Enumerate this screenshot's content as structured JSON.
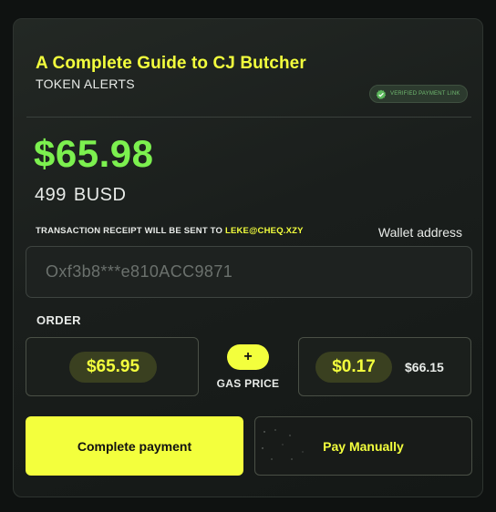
{
  "header": {
    "title": "A Complete Guide to CJ Butcher",
    "subtitle": "TOKEN ALERTS",
    "verified_badge": "VERIFIED PAYMENT LINK"
  },
  "price": {
    "amount": "$65.98",
    "token_amount": "499",
    "token_currency": "BUSD"
  },
  "receipt": {
    "prefix": "TRANSACTION RECEIPT WILL BE SENT TO",
    "email": "LEKE@CHEQ.XZY"
  },
  "wallet": {
    "label": "Wallet address",
    "placeholder": "Oxf3b8***e810ACC9871"
  },
  "order": {
    "label": "ORDER",
    "order_amount": "$65.95",
    "plus_symbol": "+",
    "gas_label": "GAS PRICE",
    "gas_amount": "$0.17",
    "total": "$66.15"
  },
  "actions": {
    "complete_label": "Complete payment",
    "manual_label": "Pay Manually"
  },
  "colors": {
    "accent": "#f3ff3d",
    "amount_green": "#7cf04f",
    "verified_green": "#6fb86f",
    "background": "#0f1211"
  }
}
